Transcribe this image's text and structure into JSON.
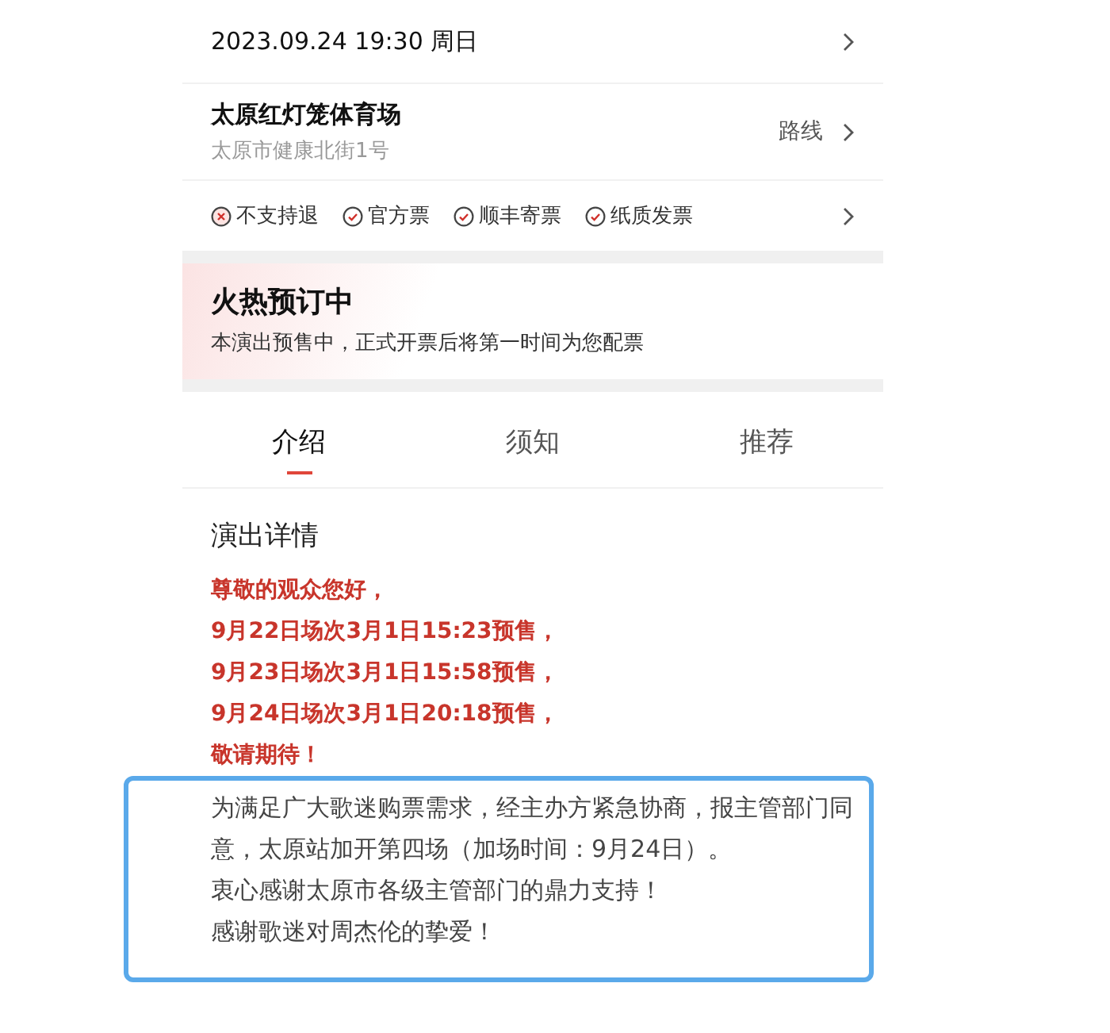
{
  "session": {
    "datetime": "2023.09.24 19:30 周日"
  },
  "venue": {
    "name": "太原红灯笼体育场",
    "address": "太原市健康北街1号",
    "route": "路线"
  },
  "services": [
    {
      "label": "不支持退",
      "supported": false
    },
    {
      "label": "官方票",
      "supported": true
    },
    {
      "label": "顺丰寄票",
      "supported": true
    },
    {
      "label": "纸质发票",
      "supported": true
    }
  ],
  "presale": {
    "title": "火热预订中",
    "note": "本演出预售中，正式开票后将第一时间为您配票"
  },
  "tabs": [
    {
      "label": "介绍",
      "selected": true
    },
    {
      "label": "须知",
      "selected": false
    },
    {
      "label": "推荐",
      "selected": false
    }
  ],
  "details": {
    "heading": "演出详情",
    "notice_lines": [
      "尊敬的观众您好，",
      "9月22日场次3月1日15:23预售，",
      "9月23日场次3月1日15:58预售，",
      "9月24日场次3月1日20:18预售，",
      "敬请期待！"
    ],
    "highlight_lines": [
      "为满足广大歌迷购票需求，经主办方紧急协商，报主管部门同意，太原站加开第四场（加场时间：9月24日）。",
      "衷心感谢太原市各级主管部门的鼎力支持！",
      "感谢歌迷对周杰伦的挚爱！"
    ]
  }
}
